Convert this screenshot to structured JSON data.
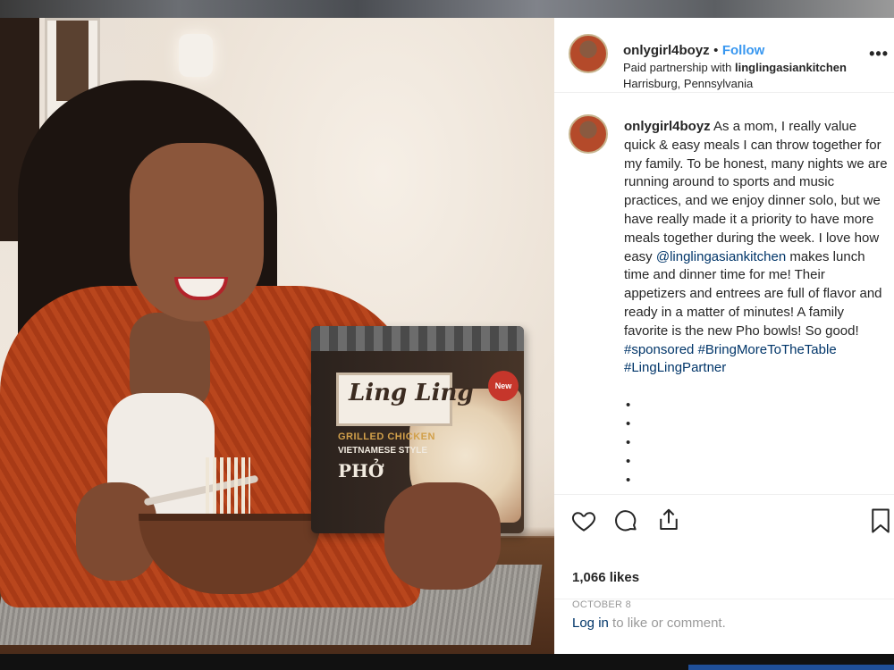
{
  "post": {
    "username": "onlygirl4boyz",
    "follow_label": "Follow",
    "separator": "•",
    "paid_prefix": "Paid partnership with ",
    "partner": "linglingasiankitchen",
    "location": "Harrisburg, Pennsylvania",
    "more_icon": "more-options-icon"
  },
  "caption": {
    "username": "onlygirl4boyz",
    "text_part1": "As a mom, I really value quick & easy meals I can throw together for my family. To be honest, many nights we are running around to sports and music practices, and we enjoy dinner solo, but we have really made it a priority to have more meals together during the week. I love how easy ",
    "mention": "@linglingasiankitchen",
    "text_part2": " makes lunch time and dinner time for me! Their appetizers and entrees are full of flavor and ready in a matter of minutes! A family favorite is the new Pho bowls! So good!",
    "hashtag1": "#sponsored",
    "hashtag2": "#BringMoreToTheTable",
    "hashtag3": "#LingLingPartner",
    "dots": [
      "•",
      "•",
      "•",
      "•",
      "•"
    ]
  },
  "actions": {
    "like_icon": "heart-icon",
    "comment_icon": "comment-icon",
    "share_icon": "share-icon",
    "save_icon": "bookmark-icon",
    "likes": "1,066 likes",
    "date": "OCTOBER 8"
  },
  "login": {
    "link": "Log in",
    "rest": " to like or comment."
  },
  "photo_package": {
    "brand": "Ling Ling",
    "line1": "GRILLED CHICKEN",
    "line2": "VIETNAMESE STYLE",
    "line3": "PHỞ",
    "badge": "New"
  },
  "colors": {
    "link_blue": "#3897f0",
    "hashtag_blue": "#003569",
    "text": "#262626",
    "muted": "#999999"
  }
}
